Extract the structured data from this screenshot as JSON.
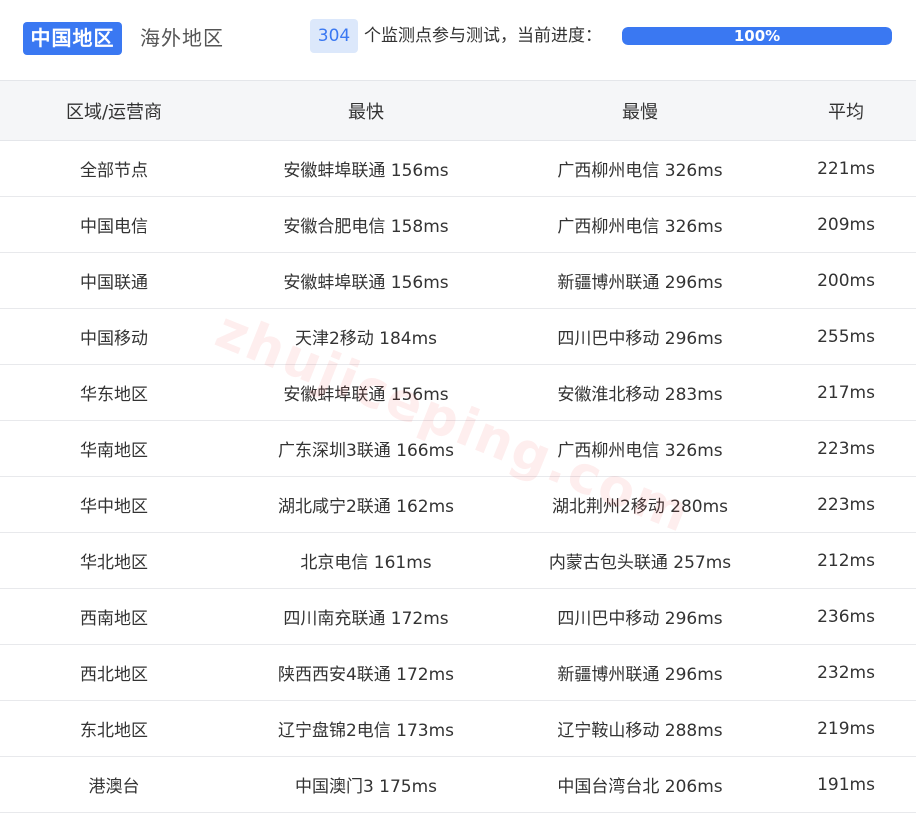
{
  "tabs": {
    "china": "中国地区",
    "overseas": "海外地区"
  },
  "monitor": {
    "count": "304",
    "label": "个监测点参与测试，当前进度：",
    "progress_text": "100%",
    "progress_value": 1.0
  },
  "table": {
    "headers": [
      "区域/运营商",
      "最快",
      "最慢",
      "平均"
    ],
    "rows": [
      [
        "全部节点",
        "安徽蚌埠联通 156ms",
        "广西柳州电信 326ms",
        "221ms"
      ],
      [
        "中国电信",
        "安徽合肥电信 158ms",
        "广西柳州电信 326ms",
        "209ms"
      ],
      [
        "中国联通",
        "安徽蚌埠联通 156ms",
        "新疆博州联通 296ms",
        "200ms"
      ],
      [
        "中国移动",
        "天津2移动 184ms",
        "四川巴中移动 296ms",
        "255ms"
      ],
      [
        "华东地区",
        "安徽蚌埠联通 156ms",
        "安徽淮北移动 283ms",
        "217ms"
      ],
      [
        "华南地区",
        "广东深圳3联通 166ms",
        "广西柳州电信 326ms",
        "223ms"
      ],
      [
        "华中地区",
        "湖北咸宁2联通 162ms",
        "湖北荆州2移动 280ms",
        "223ms"
      ],
      [
        "华北地区",
        "北京电信 161ms",
        "内蒙古包头联通 257ms",
        "212ms"
      ],
      [
        "西南地区",
        "四川南充联通 172ms",
        "四川巴中移动 296ms",
        "236ms"
      ],
      [
        "西北地区",
        "陕西西安4联通 172ms",
        "新疆博州联通 296ms",
        "232ms"
      ],
      [
        "东北地区",
        "辽宁盘锦2电信 173ms",
        "辽宁鞍山移动 288ms",
        "219ms"
      ],
      [
        "港澳台",
        "中国澳门3 175ms",
        "中国台湾台北 206ms",
        "191ms"
      ]
    ]
  },
  "watermark": "zhujiceping.com",
  "colors": {
    "accent": "#3a78f2",
    "badge_bg": "#dce8fb",
    "header_bg": "#f5f6f8"
  }
}
